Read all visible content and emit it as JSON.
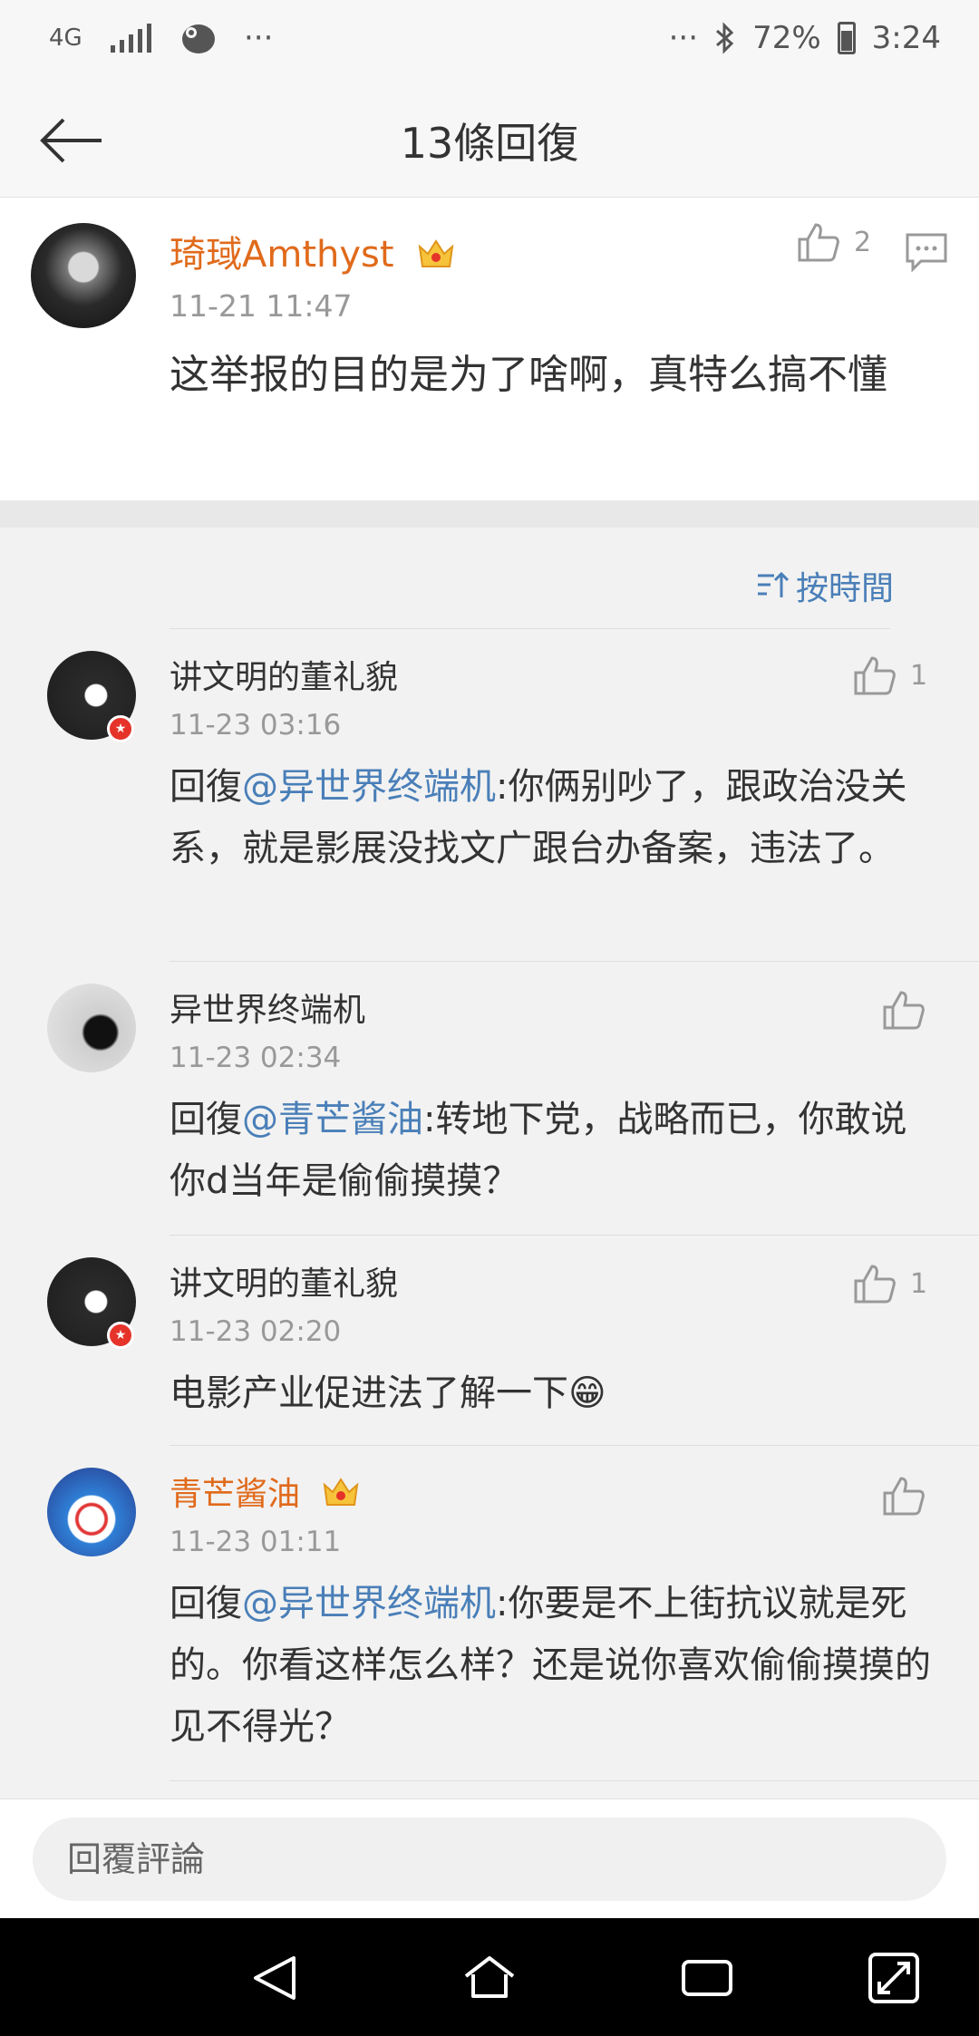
{
  "status_bar": {
    "network": "4G",
    "time": "3:24",
    "battery": "72%",
    "dots_left": "···",
    "dots_right": "···"
  },
  "header": {
    "title": "13條回復"
  },
  "main_comment": {
    "user": "琦琙Amthyst",
    "time": "11-21 11:47",
    "text": "这举报的目的是为了啥啊，真特么搞不懂",
    "likes": "2"
  },
  "sort": {
    "label": "按時間"
  },
  "replies": [
    {
      "user": "讲文明的董礼貌",
      "time": "11-23 03:16",
      "prefix": "回復",
      "mention": "@异世界终端机",
      "text": ":你俩别吵了，跟政治没关系，就是影展没找文广跟台办备案，违法了。",
      "likes": "1"
    },
    {
      "user": "异世界终端机",
      "time": "11-23 02:34",
      "prefix": "回復",
      "mention": "@青芒酱油",
      "text": ":转地下党，战略而已，你敢说你d当年是偷偷摸摸？",
      "likes": ""
    },
    {
      "user": "讲文明的董礼貌",
      "time": "11-23 02:20",
      "prefix": "",
      "mention": "",
      "text": "电影产业促进法了解一下😁",
      "likes": "1"
    },
    {
      "user": "青芒酱油",
      "time": "11-23 01:11",
      "prefix": "回復",
      "mention": "@异世界终端机",
      "text": ":你要是不上街抗议就是死的。你看这样怎么样？还是说你喜欢偷偷摸摸的见不得光？",
      "likes": ""
    }
  ],
  "footer": {
    "placeholder": "回覆評論"
  },
  "colors": {
    "vip_name": "#e06a1b",
    "mention": "#4a7fb8",
    "time": "#999999"
  }
}
